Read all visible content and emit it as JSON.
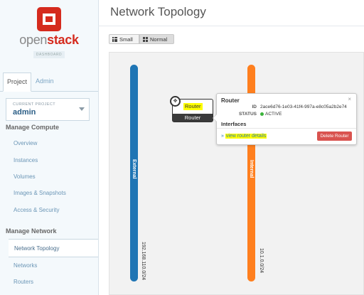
{
  "colors": {
    "accent": "#d52b1e",
    "external_net": "#1f75b4",
    "internal_net": "#ff7f1e",
    "delete": "#d9534f",
    "status_active": "#3bb33b",
    "highlight": "#ffff00"
  },
  "brand": {
    "open": "open",
    "stack": "stack",
    "badge": "DASHBOARD"
  },
  "tabs": {
    "project": "Project",
    "admin": "Admin"
  },
  "current_project": {
    "caption": "CURRENT PROJECT",
    "name": "admin"
  },
  "sidebar": {
    "compute_title": "Manage Compute",
    "compute_items": [
      "Overview",
      "Instances",
      "Volumes",
      "Images & Snapshots",
      "Access & Security"
    ],
    "network_title": "Manage Network",
    "network_items": [
      "Network Topology",
      "Networks",
      "Routers"
    ]
  },
  "page": {
    "title": "Network Topology"
  },
  "view_toggle": {
    "small": "Small",
    "normal": "Normal"
  },
  "networks": [
    {
      "name": "External",
      "cidr": "192.168.110.0/24"
    },
    {
      "name": "Internal",
      "cidr": "10.1.0.0/24"
    }
  ],
  "router_node": {
    "label": "Router",
    "type": "Router",
    "icon": "router-icon"
  },
  "popup": {
    "title": "Router",
    "close": "×",
    "id_label": "ID",
    "id_value": "2ace6d76-1e03-41f4-997a-e8c05a2b2e74",
    "status_label": "STATUS",
    "status_value": "ACTIVE",
    "interfaces_title": "Interfaces",
    "link_prefix": "»",
    "link_text": "view router details",
    "delete_label": "Delete Router"
  }
}
